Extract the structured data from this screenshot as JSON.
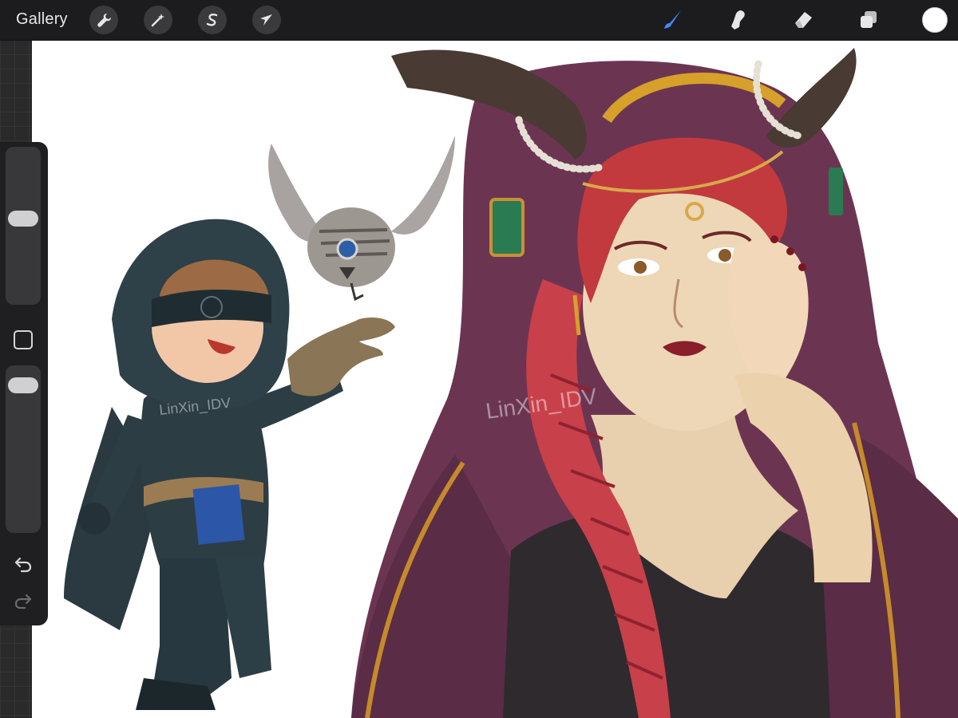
{
  "app": {
    "gallery_label": "Gallery"
  },
  "toolbar": {
    "left_tools": [
      {
        "name": "actions",
        "icon": "wrench-icon"
      },
      {
        "name": "adjustments",
        "icon": "magic-wand-icon"
      },
      {
        "name": "selection",
        "icon": "selection-s-icon"
      },
      {
        "name": "transform",
        "icon": "arrow-cursor-icon"
      }
    ],
    "right_tools": [
      {
        "name": "brush",
        "icon": "brush-icon",
        "active": true
      },
      {
        "name": "smudge",
        "icon": "smudge-finger-icon",
        "active": false
      },
      {
        "name": "eraser",
        "icon": "eraser-icon",
        "active": false
      },
      {
        "name": "layers",
        "icon": "layers-icon",
        "active": false
      }
    ],
    "current_color": "#ffffff",
    "active_tool_color": "#3f8cff"
  },
  "sidebar": {
    "brush_size_level": 0.55,
    "opacity_level": 0.92,
    "undo_icon": "undo-icon",
    "redo_icon": "redo-icon"
  },
  "canvas": {
    "watermark_left": "LinXin_IDV",
    "watermark_right": "LinXin_IDV"
  }
}
